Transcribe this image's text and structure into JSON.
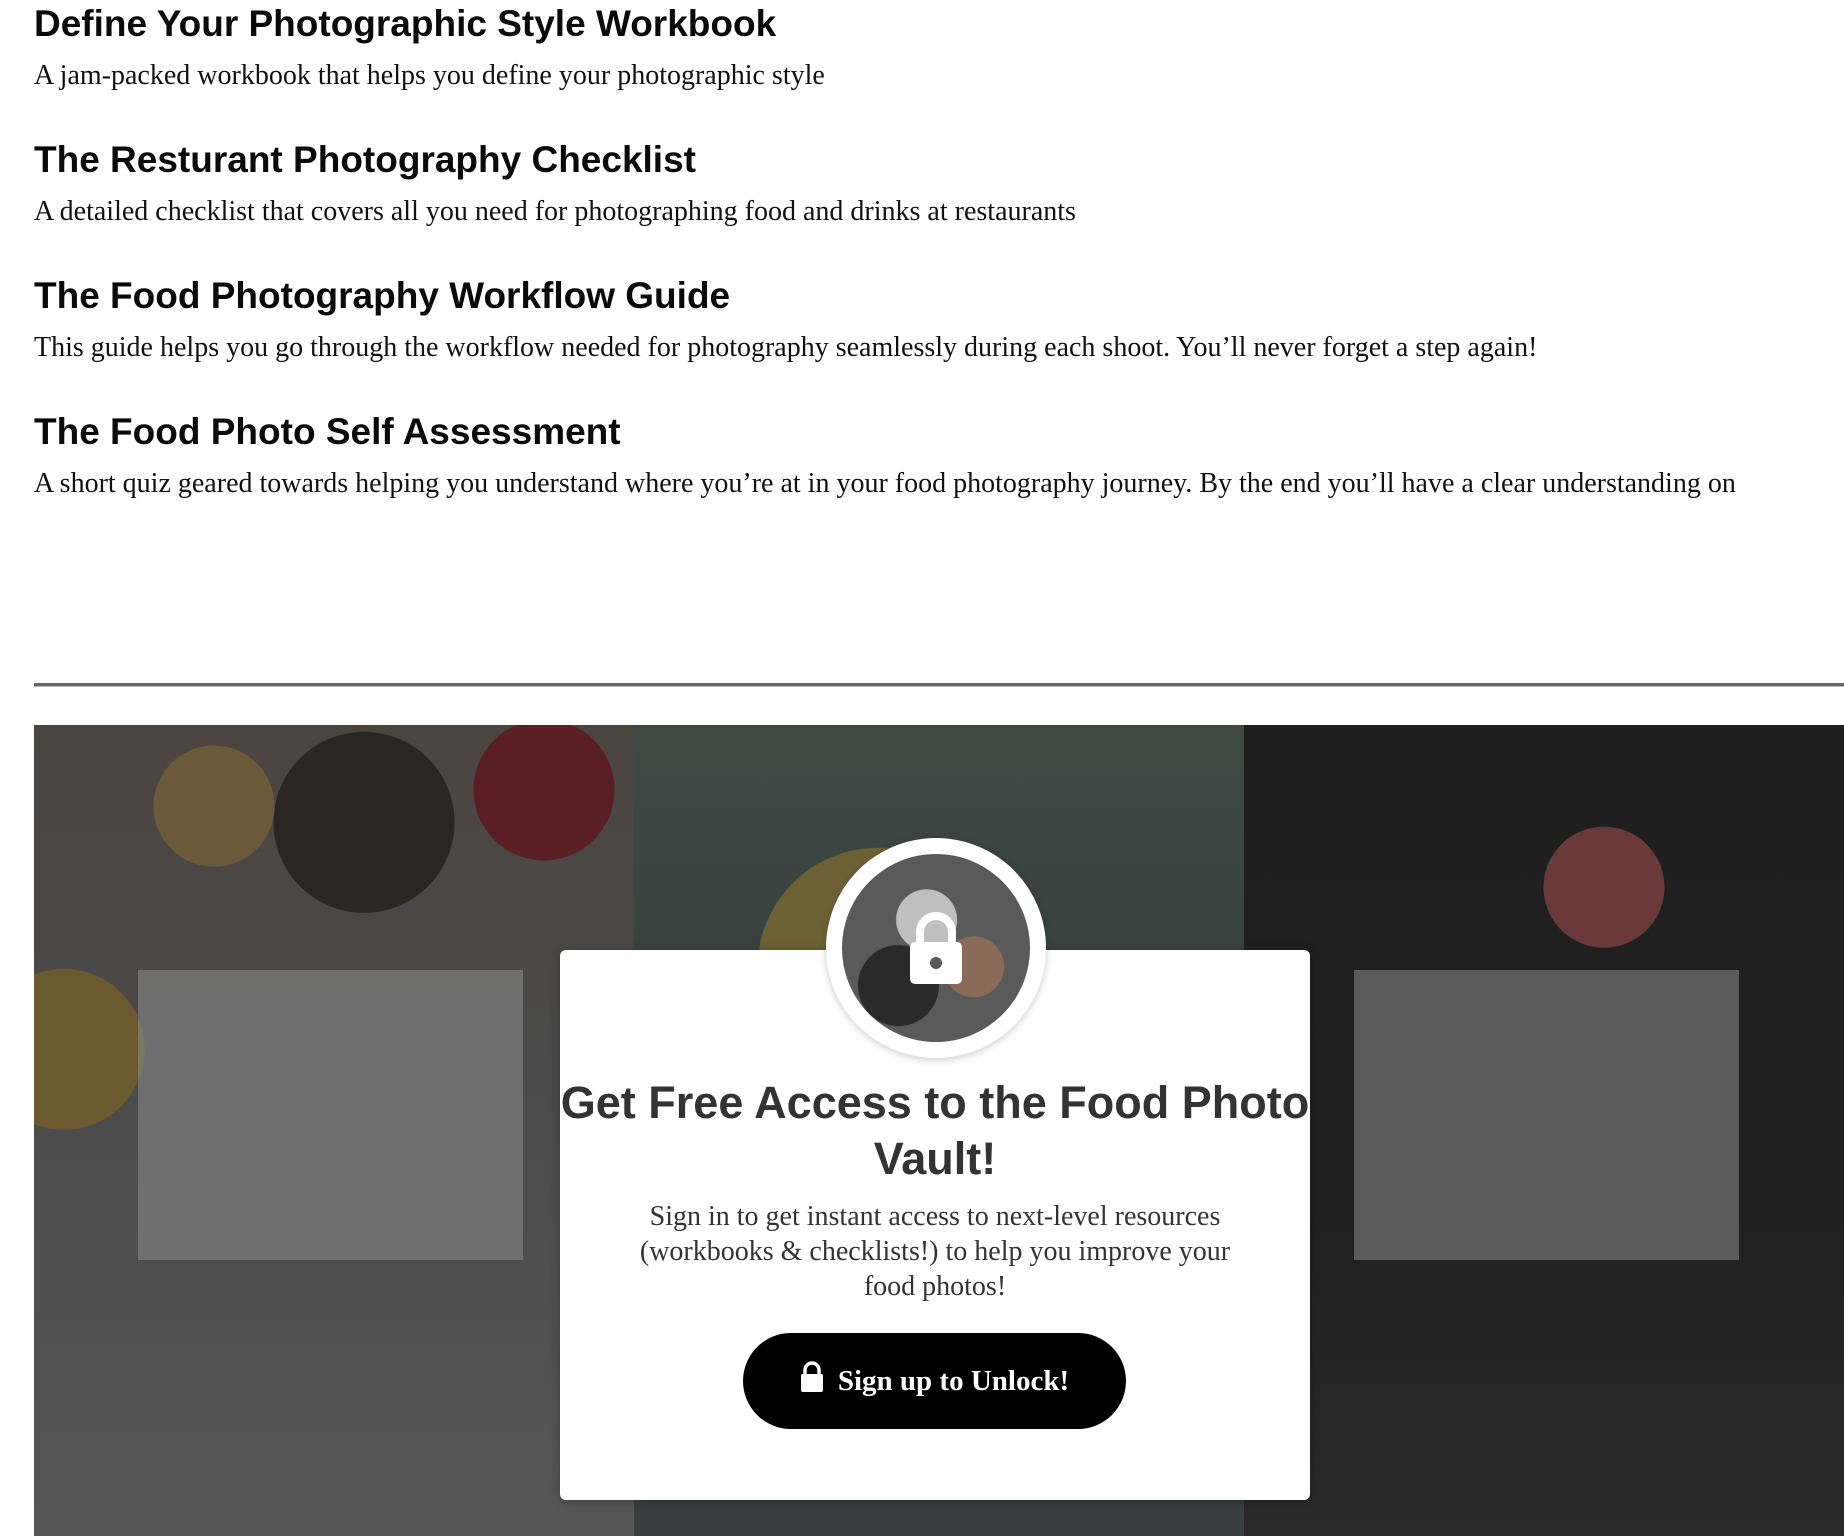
{
  "resources": [
    {
      "title": "Define Your Photographic Style Workbook",
      "description": "A jam-packed workbook that helps you define your photographic style"
    },
    {
      "title": "The Resturant Photography Checklist",
      "description": "A detailed checklist that covers all you need for photographing food and drinks at restaurants"
    },
    {
      "title": "The Food Photography Workflow Guide",
      "description": "This guide helps you go through the workflow needed for photography seamlessly during each shoot. You’ll never forget a step again!"
    },
    {
      "title": "The Food Photo Self Assessment",
      "description": "A short quiz geared towards helping you understand where you’re at in your food photography journey. By the end you’ll have a clear understanding on"
    }
  ],
  "vault": {
    "lock_icon": "lock-icon",
    "title": "Get Free Access to the Food Photo Vault!",
    "text": "Sign in to get instant access to next-level resources (workbooks & checklists!) to help you improve your food photos!",
    "button_label": "Sign up to Unlock!",
    "button_color": "#000000"
  }
}
